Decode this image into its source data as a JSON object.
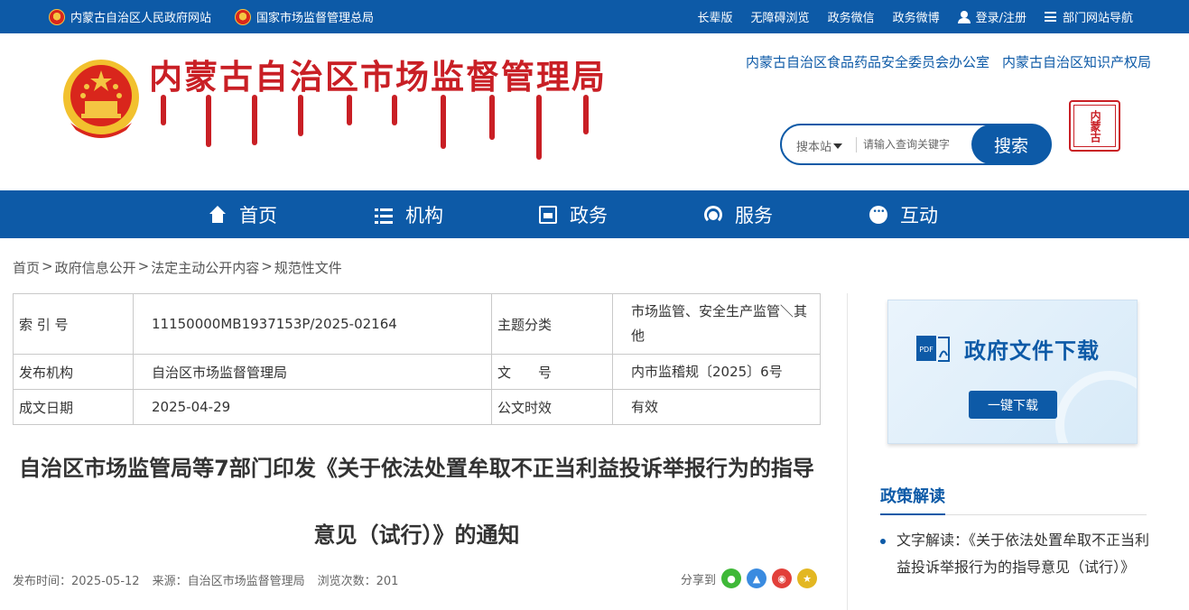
{
  "topbar": {
    "left_links": [
      "内蒙古自治区人民政府网站",
      "国家市场监督管理总局"
    ],
    "right_links": [
      "长辈版",
      "无障碍浏览",
      "政务微信",
      "政务微博"
    ],
    "login": "登录/注册",
    "dept_nav": "部门网站导航"
  },
  "header": {
    "site_title": "内蒙古自治区市场监督管理局",
    "links": [
      "内蒙古自治区食品药品安全委员会办公室",
      "内蒙古自治区知识产权局"
    ],
    "seal_text": "内蒙古"
  },
  "search": {
    "scope": "搜本站",
    "placeholder": "请输入查询关键字",
    "button": "搜索"
  },
  "nav": {
    "items": [
      {
        "label": "首页",
        "icon": "home-icon"
      },
      {
        "label": "机构",
        "icon": "list-icon"
      },
      {
        "label": "政务",
        "icon": "book-icon"
      },
      {
        "label": "服务",
        "icon": "service-icon"
      },
      {
        "label": "互动",
        "icon": "chat-icon"
      }
    ]
  },
  "breadcrumb": [
    "首页",
    "政府信息公开",
    "法定主动公开内容",
    "规范性文件"
  ],
  "meta": {
    "index_label": "索 引 号",
    "index_value": "11150000MB1937153P/2025-02164",
    "topic_label": "主题分类",
    "topic_value": "市场监管、安全生产监管＼其他",
    "org_label": "发布机构",
    "org_value": "自治区市场监督管理局",
    "docno_label": "文　　号",
    "docno_value": "内市监稽规〔2025〕6号",
    "date_label": "成文日期",
    "date_value": "2025-04-29",
    "validity_label": "公文时效",
    "validity_value": "有效"
  },
  "article": {
    "title": "自治区市场监管局等7部门印发《关于依法处置牟取不正当利益投诉举报行为的指导意见（试行）》的通知",
    "publish_time": "发布时间：2025-05-12",
    "source": "来源：自治区市场监督管理局",
    "views": "浏览次数：201",
    "share_label": "分享到"
  },
  "sidebar": {
    "download_title": "政府文件下载",
    "download_button": "一键下载",
    "policy_heading": "政策解读",
    "policy_item": "文字解读：《关于依法处置牟取不正当利益投诉举报行为的指导意见（试行）》"
  },
  "colors": {
    "brand_blue": "#0d5aa7",
    "title_red": "#c91f25"
  }
}
